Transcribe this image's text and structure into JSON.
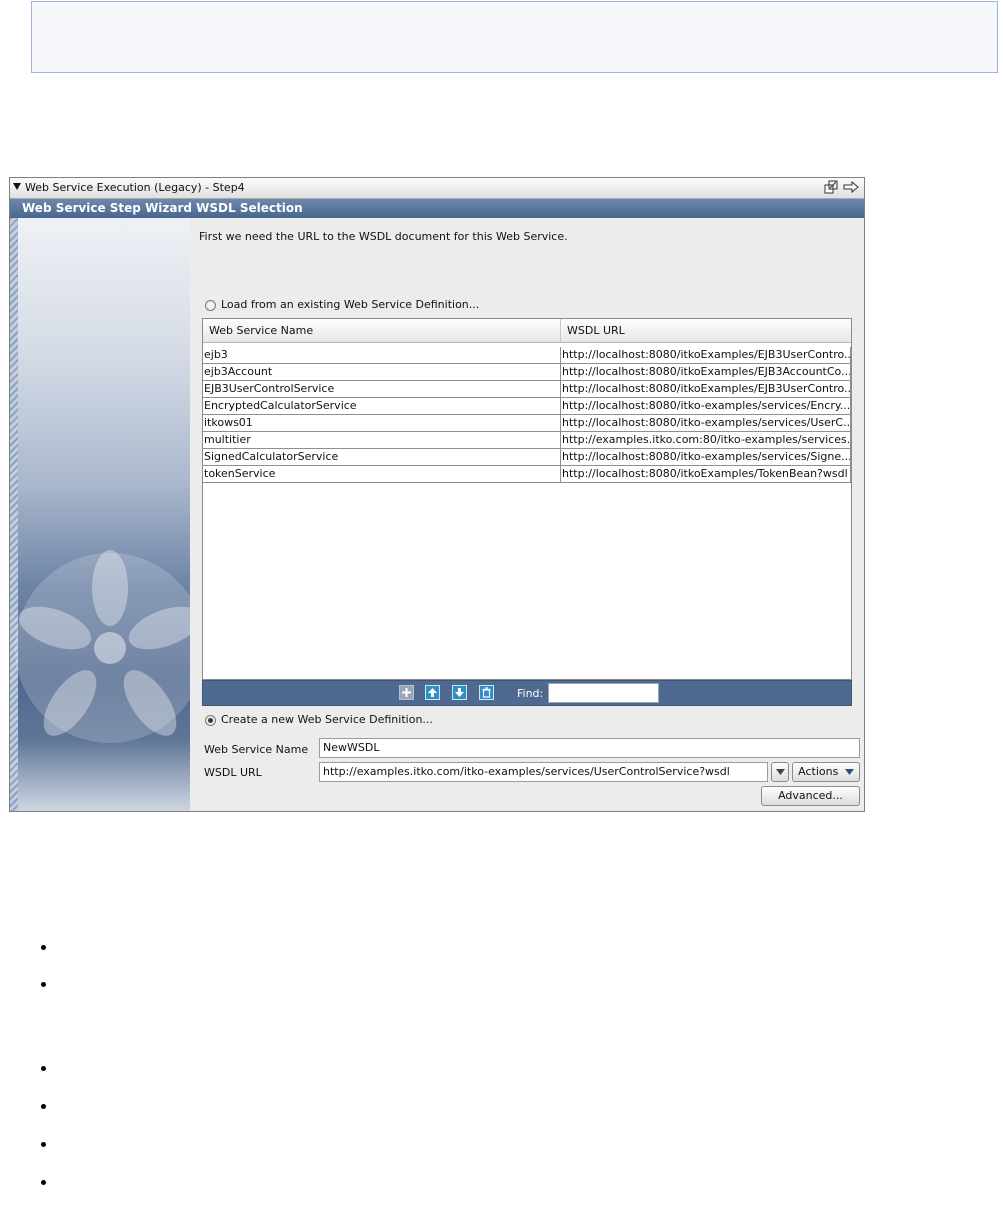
{
  "panel": {
    "title": "Web Service Execution (Legacy) - Step4"
  },
  "wizard": {
    "header": "Web Service Step Wizard WSDL Selection",
    "intro": "First we need the URL to the WSDL document for this Web Service.",
    "load_existing_label": "Load from an existing Web Service Definition...",
    "load_existing_selected": false,
    "create_new_label": "Create a new Web Service Definition...",
    "create_new_selected": true
  },
  "table": {
    "columns": [
      "Web Service Name",
      "WSDL URL"
    ],
    "rows": [
      [
        "ejb3",
        "http://localhost:8080/itkoExamples/EJB3UserContro..."
      ],
      [
        "ejb3Account",
        "http://localhost:8080/itkoExamples/EJB3AccountCo..."
      ],
      [
        "EJB3UserControlService",
        "http://localhost:8080/itkoExamples/EJB3UserContro..."
      ],
      [
        "EncryptedCalculatorService",
        "http://localhost:8080/itko-examples/services/Encry..."
      ],
      [
        "itkows01",
        "http://localhost:8080/itko-examples/services/UserC..."
      ],
      [
        "multitier",
        "http://examples.itko.com:80/itko-examples/services..."
      ],
      [
        "SignedCalculatorService",
        "http://localhost:8080/itko-examples/services/Signe..."
      ],
      [
        "tokenService",
        "http://localhost:8080/itkoExamples/TokenBean?wsdl"
      ]
    ]
  },
  "toolbar": {
    "find_label": "Find:",
    "find_value": ""
  },
  "form": {
    "name_label": "Web Service Name",
    "name_value": "NewWSDL",
    "url_label": "WSDL URL",
    "url_value": "http://examples.itko.com/itko-examples/services/UserControlService?wsdl",
    "actions_label": "Actions",
    "advanced_label": "Advanced..."
  },
  "icons": {
    "add": "plus-icon",
    "move_up": "arrow-up-icon",
    "move_down": "arrow-down-icon",
    "delete": "trash-icon",
    "maximize": "maximize-icon",
    "forward": "forward-arrow-icon"
  },
  "colors": {
    "header_blue": "#48678f",
    "toolbar_blue": "#4e6a90",
    "button_blue": "#2e8fc9"
  }
}
